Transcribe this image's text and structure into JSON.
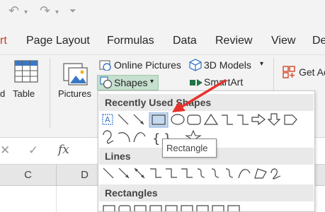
{
  "qat": {
    "undo_icon": "undo-icon",
    "redo_icon": "redo-icon",
    "customize_icon": "customize-arrow-icon"
  },
  "tabs": [
    {
      "label": "rt"
    },
    {
      "label": "Page Layout"
    },
    {
      "label": "Formulas"
    },
    {
      "label": "Data"
    },
    {
      "label": "Review"
    },
    {
      "label": "View"
    },
    {
      "label": "De"
    }
  ],
  "ribbon": {
    "partial_label": "d",
    "table_label": "Table",
    "pictures_label": "Pictures",
    "online_pictures_label": "Online Pictures",
    "shapes_label": "Shapes",
    "shapes_arrow": "▾",
    "models_label": "3D Models",
    "models_arrow": "▾",
    "smartart_label": "SmartArt",
    "get_addins_label": "Get Ac"
  },
  "formula_bar": {
    "cancel": "✕",
    "enter": "✓",
    "fx": "fx"
  },
  "columns": [
    "C",
    "D"
  ],
  "gallery": {
    "recently_used_title": "Recently Used Shapes",
    "lines_title": "Lines",
    "rectangles_title": "Rectangles",
    "tooltip": "Rectangle",
    "hovered_shape": "Rectangle"
  },
  "colors": {
    "accent_green": "#217346",
    "shapes_button_bg": "#c6dfce",
    "hover_highlight": "#c5d9f1",
    "annotation_arrow": "#e8302a"
  }
}
